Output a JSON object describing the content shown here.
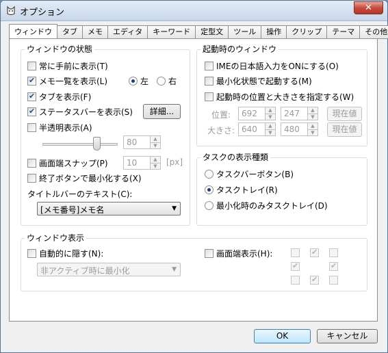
{
  "window": {
    "title": "オプション",
    "close_label": "✕"
  },
  "tabs": [
    "ウィンドウ",
    "タブ",
    "メモ",
    "エディタ",
    "キーワード",
    "定型文",
    "ツール",
    "操作",
    "クリップ",
    "テーマ",
    "その他"
  ],
  "window_state": {
    "label": "ウィンドウの状態",
    "always_on_top": "常に手前に表示(T)",
    "show_memo_list": "メモ一覧を表示(L)",
    "left": "左",
    "right": "右",
    "show_tabs": "タブを表示(F)",
    "show_statusbar": "ステータスバーを表示(S)",
    "details_button": "詳細...",
    "translucent": "半透明表示(A)",
    "opacity_value": "80",
    "edge_snap": "画面端スナップ(P)",
    "snap_value": "10",
    "snap_unit": "[px]",
    "minimize_on_close": "終了ボタンで最小化する(X)",
    "titlebar_text_label": "タイトルバーのテキスト(C):",
    "titlebar_text_value": "[メモ番号]メモ名"
  },
  "startup_window": {
    "label": "起動時のウィンドウ",
    "ime_on": "IMEの日本語入力をONにする(O)",
    "start_minimized": "最小化状態で起動する(M)",
    "set_position_size": "起動時の位置と大きさを指定する(W)",
    "position_label": "位置:",
    "pos_x": "692",
    "pos_y": "247",
    "size_label": "大きさ:",
    "size_w": "640",
    "size_h": "480",
    "current_button": "現在値"
  },
  "task_display": {
    "label": "タスクの表示種類",
    "taskbar_button": "タスクバーボタン(B)",
    "task_tray": "タスクトレイ(R)",
    "tray_minimized_only": "最小化時のみタスクトレイ(D)"
  },
  "window_display": {
    "label": "ウィンドウ表示",
    "auto_hide": "自動的に隠す(N):",
    "auto_hide_option": "非アクティブ時に最小化",
    "edge_display": "画面端表示(H):"
  },
  "footer": {
    "ok": "OK",
    "cancel": "キャンセル"
  }
}
